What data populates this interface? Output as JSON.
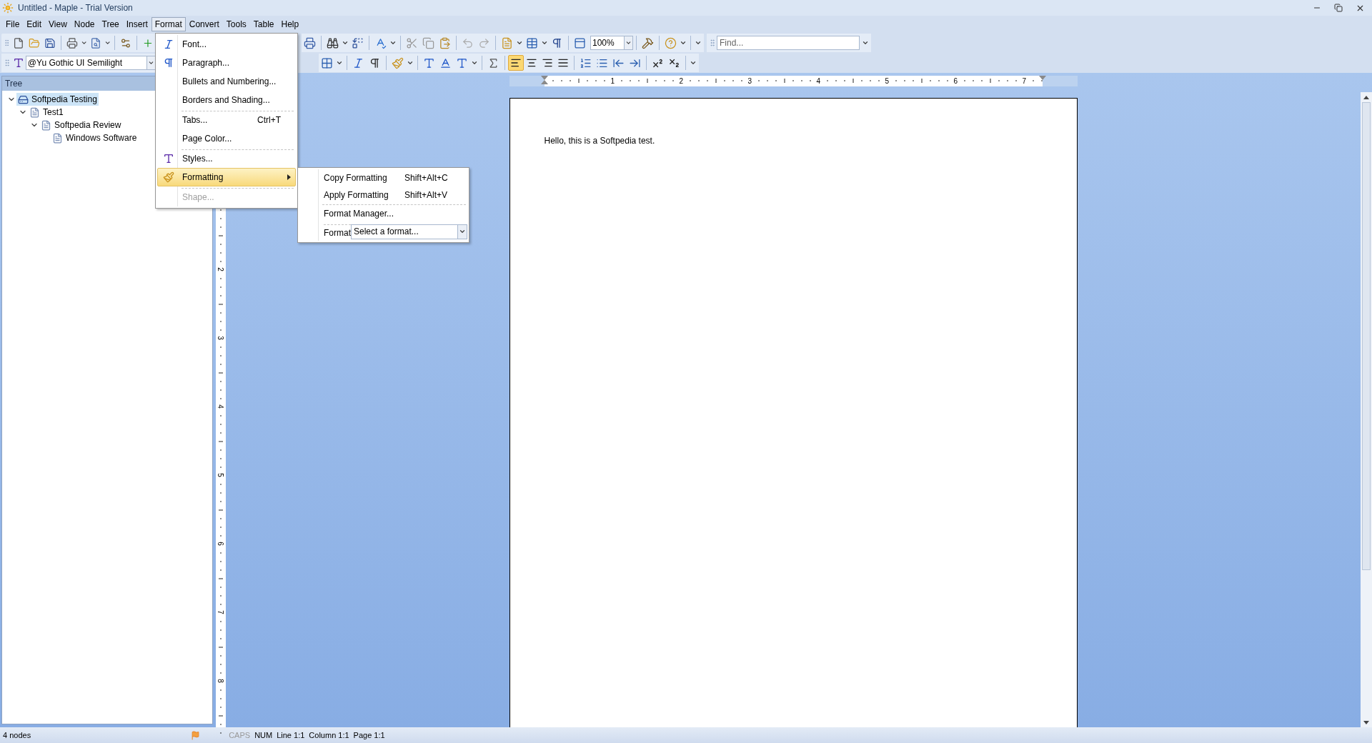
{
  "window": {
    "title": "Untitled - Maple - Trial Version"
  },
  "menu_bar": [
    {
      "label": "File",
      "selected": false
    },
    {
      "label": "Edit",
      "selected": false
    },
    {
      "label": "View",
      "selected": false
    },
    {
      "label": "Node",
      "selected": false
    },
    {
      "label": "Tree",
      "selected": false
    },
    {
      "label": "Insert",
      "selected": false
    },
    {
      "label": "Format",
      "selected": true
    },
    {
      "label": "Convert",
      "selected": false
    },
    {
      "label": "Tools",
      "selected": false
    },
    {
      "label": "Table",
      "selected": false
    },
    {
      "label": "Help",
      "selected": false
    }
  ],
  "toolbar": {
    "font": "@Yu Gothic UI Semilight",
    "zoom": "100%",
    "find_placeholder": "Find...",
    "alignment_buttons": [
      {
        "selected": true
      },
      {
        "selected": false
      },
      {
        "selected": false
      },
      {
        "selected": false
      }
    ]
  },
  "format_menu": [
    {
      "label": "Font...",
      "separator_before": false,
      "disabled": false,
      "selected": false,
      "submenu": false
    },
    {
      "label": "Paragraph...",
      "separator_before": false,
      "disabled": false,
      "selected": false,
      "submenu": false
    },
    {
      "label": "Bullets and Numbering...",
      "separator_before": false,
      "disabled": false,
      "selected": false,
      "submenu": false
    },
    {
      "label": "Borders and Shading...",
      "separator_before": false,
      "disabled": false,
      "selected": false,
      "submenu": false
    },
    {
      "label": "Tabs...",
      "shortcut": "Ctrl+T",
      "separator_before": true,
      "disabled": false,
      "selected": false,
      "submenu": false
    },
    {
      "label": "Page Color...",
      "separator_before": false,
      "disabled": false,
      "selected": false,
      "submenu": false
    },
    {
      "label": "Styles...",
      "separator_before": true,
      "disabled": false,
      "selected": false,
      "submenu": false
    },
    {
      "label": "Formatting",
      "separator_before": false,
      "disabled": false,
      "selected": true,
      "submenu": true
    },
    {
      "label": "Shape...",
      "separator_before": true,
      "disabled": true,
      "selected": false,
      "submenu": false
    }
  ],
  "formatting_submenu": [
    {
      "kind": "item",
      "label": "Copy Formatting",
      "shortcut": "Shift+Alt+C",
      "separator_before": false
    },
    {
      "kind": "item",
      "label": "Apply Formatting",
      "shortcut": "Shift+Alt+V",
      "separator_before": false
    },
    {
      "kind": "item",
      "label": "Format Manager...",
      "separator_before": true
    },
    {
      "kind": "combo",
      "label": "Format",
      "value": "Select a format...",
      "separator_before": true
    }
  ],
  "tree": {
    "header": "Tree",
    "nodes": [
      {
        "label": "Softpedia Testing",
        "kind": "project",
        "selected": true,
        "expanded": true,
        "children": [
          {
            "label": "Test1",
            "kind": "page",
            "selected": false,
            "expanded": true,
            "children": [
              {
                "label": "Softpedia Review",
                "kind": "page",
                "selected": false,
                "expanded": true,
                "children": [
                  {
                    "label": "Windows Software",
                    "kind": "page",
                    "selected": false
                  }
                ]
              }
            ]
          }
        ]
      }
    ]
  },
  "horizontal_ruler": {
    "labels": [
      "1",
      "2",
      "3",
      "4",
      "5",
      "6",
      "7"
    ]
  },
  "vertical_ruler": {
    "labels": [
      "2",
      "3",
      "4",
      "5",
      "6",
      "7",
      "8"
    ]
  },
  "document": {
    "text": "Hello, this is a Softpedia test."
  },
  "status_bar": {
    "nodes": "4 nodes",
    "indicators": [
      {
        "label": "CAPS",
        "on": false
      },
      {
        "label": "NUM",
        "on": true
      }
    ],
    "position": [
      "Line 1:1",
      "Column 1:1",
      "Page 1:1"
    ]
  }
}
